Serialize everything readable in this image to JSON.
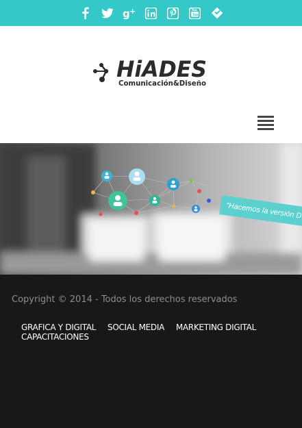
{
  "social": {
    "icons": [
      "facebook-icon",
      "twitter-icon",
      "google-plus-icon",
      "linkedin-icon",
      "pinterest-icon",
      "youtube-icon",
      "foursquare-icon"
    ]
  },
  "header": {
    "logo_name": "HiADES",
    "logo_tagline": "Comunicación&Diseño"
  },
  "hero": {
    "banner_text": "\"Hacemos la versión D"
  },
  "footer": {
    "copyright": "Copyright © 2014 - Todos los derechos reservados",
    "nav": [
      "GRAFICA Y DIGITAL",
      "SOCIAL MEDIA",
      "MARKETING DIGITAL",
      "CAPACITACIONES"
    ]
  },
  "colors": {
    "accent": "#35c8c8",
    "footer_bg": "#181818"
  }
}
